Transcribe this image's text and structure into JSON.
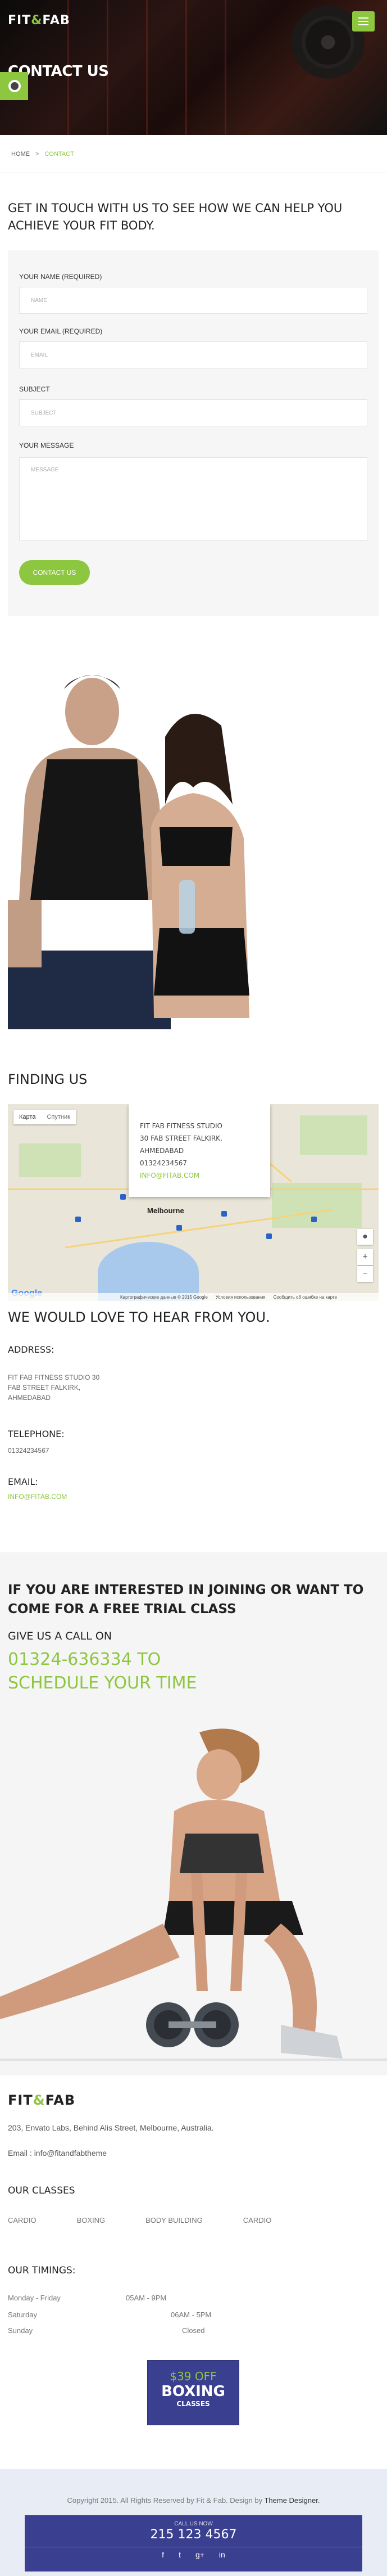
{
  "brand": {
    "name_a": "FIT",
    "name_amp": "&",
    "name_b": "FAB"
  },
  "hero": {
    "title": "CONTACT US"
  },
  "breadcrumb": {
    "home": "HOME",
    "sep": ">",
    "current": "CONTACT"
  },
  "form": {
    "intro": "GET IN TOUCH WITH US TO SEE HOW WE CAN HELP YOU ACHIEVE YOUR FIT BODY.",
    "name_label": "YOUR NAME (REQUIRED)",
    "name_placeholder": "NAME",
    "email_label": "YOUR EMAIL (REQUIRED)",
    "email_placeholder": "EMAIL",
    "subject_label": "SUBJECT",
    "subject_placeholder": "SUBJECT",
    "message_label": "YOUR MESSAGE",
    "message_placeholder": "MESSAGE",
    "submit_label": "CONTACT US"
  },
  "map_section": {
    "title": "FINDING US",
    "tab_map": "Карта",
    "tab_sat": "Спутник",
    "city": "Melbourne",
    "info_lines": [
      "FIT FAB FITNESS STUDIO",
      "30 FAB STREET FALKIRK,",
      "AHMEDABAD",
      "01324234567"
    ],
    "info_email": "INFO@FITAB.COM",
    "zoom_in": "+",
    "zoom_out": "−",
    "google": "Google",
    "footer_links": [
      "Картографические данные © 2015 Google",
      "Условия использования",
      "Сообщить об ошибке на карте"
    ]
  },
  "contact_info": {
    "title": "WE WOULD LOVE TO HEAR FROM YOU.",
    "address_label": "ADDRESS:",
    "address_lines": [
      "FIT FAB FITNESS STUDIO 30",
      "FAB STREET FALKIRK,",
      "AHMEDABAD"
    ],
    "telephone_label": "TELEPHONE:",
    "telephone": "01324234567",
    "email_label": "EMAIL:",
    "email": "INFO@FITAB.COM"
  },
  "trial": {
    "title": "IF YOU ARE INTERESTED IN JOINING OR WANT TO COME FOR A FREE TRIAL CLASS",
    "call": "GIVE US A CALL ON",
    "phone": "01324-636334 TO",
    "schedule": "SCHEDULE YOUR TIME"
  },
  "footer": {
    "address": "203, Envato Labs, Behind Alis Street, Melbourne, Australia.",
    "email_prefix": "Email : ",
    "email": "info@fitandfabtheme",
    "classes_title": "OUR CLASSES",
    "classes": [
      "CARDIO",
      "BOXING",
      "BODY BUILDING",
      "CARDIO"
    ],
    "timings_title": "OUR TIMINGS:",
    "timings": [
      {
        "day": "Monday - Friday",
        "time": "05AM - 9PM"
      },
      {
        "day": "Saturday",
        "time": "06AM - 5PM"
      },
      {
        "day": "Sunday",
        "time": "Closed"
      }
    ],
    "promo": {
      "off": "$39 OFF",
      "big": "BOXING",
      "small": "CLASSES"
    },
    "copyright": "Copyright 2015. All Rights Reserved by Fit & Fab. Design by ",
    "designer": "Theme Designer.",
    "call_us": "CALL US NOW",
    "phone": "215 123 4567",
    "social": [
      "f",
      "t",
      "g+",
      "in"
    ]
  },
  "colors": {
    "accent": "#8dc63f",
    "navy": "#3a3f8f"
  }
}
